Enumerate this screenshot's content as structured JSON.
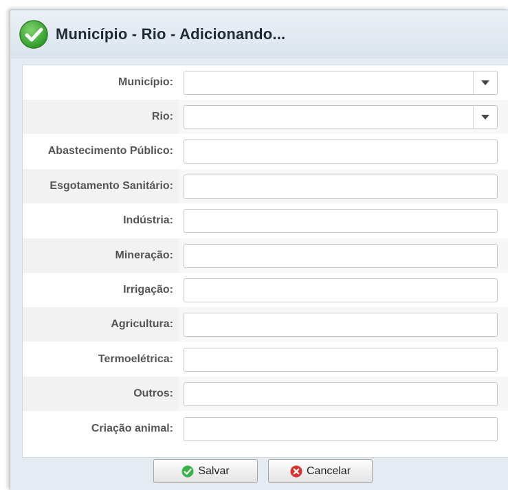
{
  "dialog": {
    "title": "Município - Rio - Adicionando...",
    "title_icon": "check-circle-icon"
  },
  "form": {
    "municipio": {
      "label": "Município:",
      "value": ""
    },
    "rio": {
      "label": "Rio:",
      "value": ""
    },
    "abastecimento": {
      "label": "Abastecimento Público:",
      "value": ""
    },
    "esgotamento": {
      "label": "Esgotamento Sanitário:",
      "value": ""
    },
    "industria": {
      "label": "Indústria:",
      "value": ""
    },
    "mineracao": {
      "label": "Mineração:",
      "value": ""
    },
    "irrigacao": {
      "label": "Irrigação:",
      "value": ""
    },
    "agricultura": {
      "label": "Agricultura:",
      "value": ""
    },
    "termoeletrica": {
      "label": "Termoelétrica:",
      "value": ""
    },
    "outros": {
      "label": "Outros:",
      "value": ""
    },
    "criacao_animal": {
      "label": "Criação animal:",
      "value": ""
    }
  },
  "buttons": {
    "save": {
      "label": "Salvar",
      "icon": "check-circle-icon",
      "color": "#3bb34a"
    },
    "cancel": {
      "label": "Cancelar",
      "icon": "x-circle-icon",
      "color": "#d9322d"
    }
  }
}
